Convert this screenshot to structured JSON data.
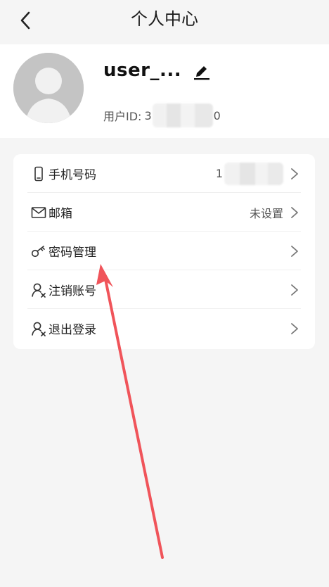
{
  "header": {
    "title": "个人中心",
    "back_icon": "chevron-left-icon"
  },
  "profile": {
    "username": "user_...",
    "userid_label": "用户ID:",
    "userid_prefix": "3",
    "userid_suffix": "0",
    "edit_icon": "edit-icon",
    "avatar_icon": "default-avatar-icon"
  },
  "menu": {
    "items": [
      {
        "label": "手机号码",
        "value": "1",
        "icon": "phone-icon"
      },
      {
        "label": "邮箱",
        "value": "未设置",
        "icon": "mail-icon"
      },
      {
        "label": "密码管理",
        "value": "",
        "icon": "key-icon"
      },
      {
        "label": "注销账号",
        "value": "",
        "icon": "user-remove-icon"
      },
      {
        "label": "退出登录",
        "value": "",
        "icon": "user-logout-icon"
      }
    ]
  },
  "colors": {
    "background": "#f5f5f5",
    "card": "#ffffff",
    "text": "#222222",
    "secondary_text": "#555555",
    "arrow_annotation": "#f0545a"
  }
}
